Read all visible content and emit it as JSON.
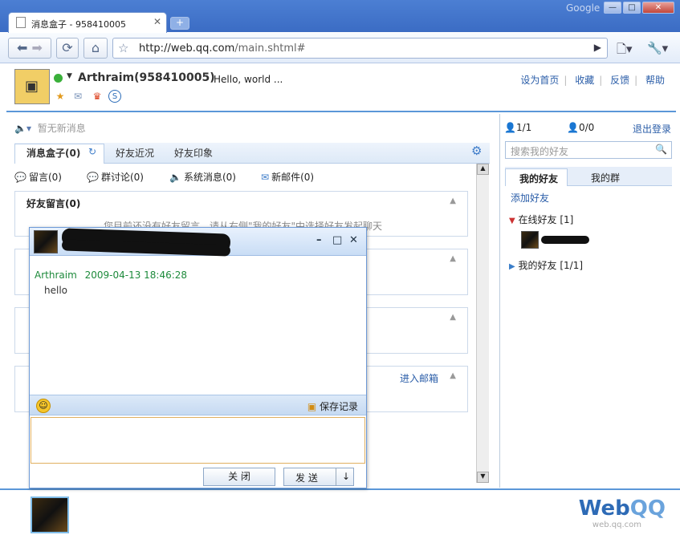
{
  "browser": {
    "tab_title": "消息盒子 - 958410005",
    "tab_close": "✕",
    "new_tab": "+",
    "brand": "Google",
    "url_host": "http://web.qq.com",
    "url_path": "/main.shtml#"
  },
  "header": {
    "username": "Arthraim(958410005)",
    "signature": "Hello, world ...",
    "nav": [
      "设为首页",
      "收藏",
      "反馈",
      "帮助"
    ]
  },
  "left": {
    "notice": "暂无新消息",
    "tabs": [
      "消息盒子(0)",
      "好友近况",
      "好友印象"
    ],
    "subtabs": [
      "留言(0)",
      "群讨论(0)",
      "系统消息(0)",
      "新邮件(0)"
    ],
    "box1_title": "好友留言(0)",
    "box1_text": "您目前还没有好友留言，请从右侧\"我的好友\"中选择好友发起聊天",
    "mail_link": "进入邮箱"
  },
  "right": {
    "online_count": "1/1",
    "other_count": "0/0",
    "logout": "退出登录",
    "search_placeholder": "搜索我的好友",
    "tabs": [
      "我的好友",
      "我的群"
    ],
    "add_friend": "添加好友",
    "groups": [
      "在线好友 [1]",
      "我的好友 [1/1]"
    ]
  },
  "chat": {
    "sender": "Arthraim",
    "time": "2009-04-13 18:46:28",
    "message": "hello",
    "save_history": "保存记录",
    "close": "关 闭",
    "send": "发 送"
  },
  "footer": {
    "logo_web": "Web",
    "logo_qq": "QQ",
    "logo_url": "web.qq.com"
  }
}
